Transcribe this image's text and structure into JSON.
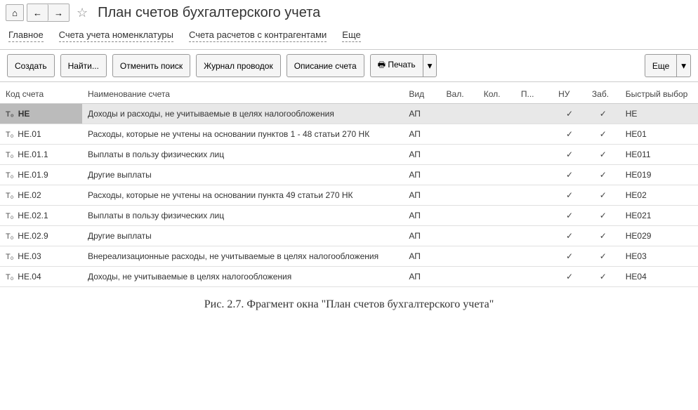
{
  "nav": {
    "home": "⌂",
    "back": "←",
    "fwd": "→"
  },
  "title": "План счетов бухгалтерского учета",
  "tabs": {
    "main": "Главное",
    "nomenclature": "Счета учета номенклатуры",
    "contractors": "Счета расчетов с контрагентами",
    "more": "Еще"
  },
  "actions": {
    "create": "Создать",
    "find": "Найти...",
    "cancel_search": "Отменить поиск",
    "journal": "Журнал проводок",
    "description": "Описание счета",
    "print": "Печать",
    "more": "Еще"
  },
  "headers": {
    "code": "Код счета",
    "name": "Наименование счета",
    "vid": "Вид",
    "val": "Вал.",
    "kol": "Кол.",
    "p": "П...",
    "nu": "НУ",
    "zab": "Заб.",
    "quick": "Быстрый выбор"
  },
  "rows": [
    {
      "t": "Т₀",
      "code": "НЕ",
      "name": "Доходы и расходы, не учитываемые в целях налогообложения",
      "vid": "АП",
      "nu": true,
      "zab": true,
      "quick": "НЕ",
      "selected": true
    },
    {
      "t": "Т₀",
      "code": "НЕ.01",
      "name": "Расходы, которые не учтены на основании пунктов 1 - 48 статьи 270 НК",
      "vid": "АП",
      "nu": true,
      "zab": true,
      "quick": "НЕ01"
    },
    {
      "t": "Т₀",
      "code": "НЕ.01.1",
      "name": "Выплаты в пользу физических лиц",
      "vid": "АП",
      "nu": true,
      "zab": true,
      "quick": "НЕ011"
    },
    {
      "t": "Т₀",
      "code": "НЕ.01.9",
      "name": "Другие выплаты",
      "vid": "АП",
      "nu": true,
      "zab": true,
      "quick": "НЕ019"
    },
    {
      "t": "Т₀",
      "code": "НЕ.02",
      "name": "Расходы, которые не учтены на основании пункта 49 статьи 270 НК",
      "vid": "АП",
      "nu": true,
      "zab": true,
      "quick": "НЕ02"
    },
    {
      "t": "Т₀",
      "code": "НЕ.02.1",
      "name": "Выплаты в пользу физических лиц",
      "vid": "АП",
      "nu": true,
      "zab": true,
      "quick": "НЕ021"
    },
    {
      "t": "Т₀",
      "code": "НЕ.02.9",
      "name": "Другие выплаты",
      "vid": "АП",
      "nu": true,
      "zab": true,
      "quick": "НЕ029"
    },
    {
      "t": "Т₀",
      "code": "НЕ.03",
      "name": "Внереализационные расходы, не учитываемые в целях налогообложения",
      "vid": "АП",
      "nu": true,
      "zab": true,
      "quick": "НЕ03"
    },
    {
      "t": "Т₀",
      "code": "НЕ.04",
      "name": "Доходы, не учитываемые в целях налогообложения",
      "vid": "АП",
      "nu": true,
      "zab": true,
      "quick": "НЕ04"
    }
  ],
  "caption": "Рис. 2.7. Фрагмент окна \"План счетов бухгалтерского учета\""
}
